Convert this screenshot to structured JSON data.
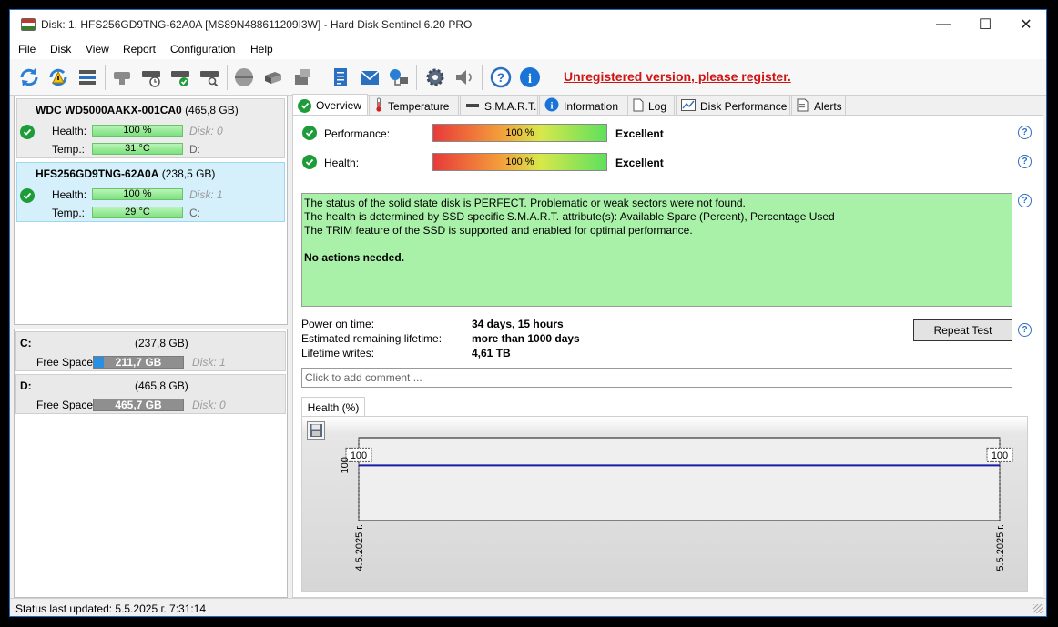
{
  "window": {
    "title": "Disk: 1, HFS256GD9TNG-62A0A [MS89N488611209I3W]  -  Hard Disk Sentinel 6.20 PRO",
    "min_glyph": "—",
    "max_glyph": "☐",
    "close_glyph": "✕"
  },
  "menu": [
    "File",
    "Disk",
    "View",
    "Report",
    "Configuration",
    "Help"
  ],
  "toolbar": {
    "icons": [
      "refresh-icon",
      "refresh-warning-icon",
      "disk-list-icon",
      "disk-gray-icon",
      "disk-clock-icon",
      "disk-check-icon",
      "disk-search-icon",
      "disk-surface-icon",
      "disk-transfer-icon",
      "disk-export-icon",
      "report-icon",
      "mail-icon",
      "network-icon",
      "settings-icon",
      "sound-icon",
      "help-icon",
      "info-icon"
    ],
    "unregistered_text": "Unregistered version, please register."
  },
  "disks": [
    {
      "name": "WDC WD5000AAKX-001CA0",
      "size": "(465,8 GB)",
      "health_label": "Health:",
      "health": "100 %",
      "disk_id": "Disk: 0",
      "temp_label": "Temp.:",
      "temp": "31 °C",
      "drive": "D:"
    },
    {
      "name": "HFS256GD9TNG-62A0A",
      "size": "(238,5 GB)",
      "health_label": "Health:",
      "health": "100 %",
      "disk_id": "Disk: 1",
      "temp_label": "Temp.:",
      "temp": "29 °C",
      "drive": "C:"
    }
  ],
  "volumes": [
    {
      "letter": "C:",
      "size": "(237,8 GB)",
      "free_label": "Free Space",
      "free": "211,7 GB",
      "free_fraction": 0.11,
      "disk_id": "Disk: 1"
    },
    {
      "letter": "D:",
      "size": "(465,8 GB)",
      "free_label": "Free Space",
      "free": "465,7 GB",
      "free_fraction": 0.0,
      "disk_id": "Disk: 0"
    }
  ],
  "tabs": [
    "Overview",
    "Temperature",
    "S.M.A.R.T.",
    "Information",
    "Log",
    "Disk Performance",
    "Alerts"
  ],
  "overview": {
    "performance_label": "Performance:",
    "performance_value": "100 %",
    "performance_rating": "Excellent",
    "health_label": "Health:",
    "health_value": "100 %",
    "health_rating": "Excellent",
    "status_lines": [
      "The status of the solid state disk is PERFECT. Problematic or weak sectors were not found.",
      "The health is determined by SSD specific S.M.A.R.T. attribute(s):  Available Spare (Percent), Percentage Used",
      "The TRIM feature of the SSD is supported and enabled for optimal performance."
    ],
    "status_action": "No actions needed.",
    "power_on_label": "Power on time:",
    "power_on_value": "34 days, 15 hours",
    "lifetime_label": "Estimated remaining lifetime:",
    "lifetime_value": "more than 1000 days",
    "writes_label": "Lifetime writes:",
    "writes_value": "4,61 TB",
    "repeat_test": "Repeat Test",
    "comment_placeholder": "Click to add comment ...",
    "help_glyph": "?"
  },
  "chart_data": {
    "type": "line",
    "tab_label": "Health (%)",
    "x": [
      "4.5.2025 г.",
      "5.5.2025 г."
    ],
    "series": [
      {
        "values": [
          100,
          100
        ]
      }
    ],
    "point_labels": [
      "100",
      "100"
    ],
    "y_tick_labels": [
      "100"
    ],
    "xlabel": "",
    "ylabel": "",
    "grid": false,
    "line_color": "#1a1aa8"
  },
  "statusbar": {
    "text": "Status last updated: 5.5.2025 г. 7:31:14"
  }
}
